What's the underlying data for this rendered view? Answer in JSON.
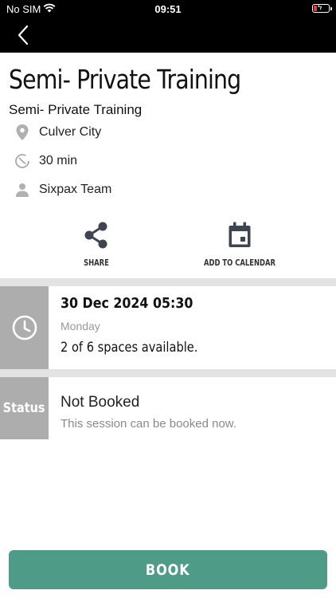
{
  "status_bar": {
    "carrier": "No SIM",
    "time": "09:51"
  },
  "title": "Semi- Private Training",
  "subtitle": "Semi- Private Training",
  "details": {
    "location": "Culver City",
    "duration": "30 min",
    "instructor": "Sixpax Team"
  },
  "actions": {
    "share_label": "SHARE",
    "calendar_label": "ADD TO CALENDAR"
  },
  "session": {
    "datetime": "30 Dec 2024  05:30",
    "day": "Monday",
    "spaces": "2 of 6 spaces available."
  },
  "booking_status": {
    "label": "Status",
    "value": "Not Booked",
    "description": "This session can be booked now."
  },
  "book_button": "BOOK",
  "colors": {
    "accent": "#4e9c88",
    "panel": "#adadad",
    "separator": "#e3e3e3",
    "header": "#000000"
  }
}
